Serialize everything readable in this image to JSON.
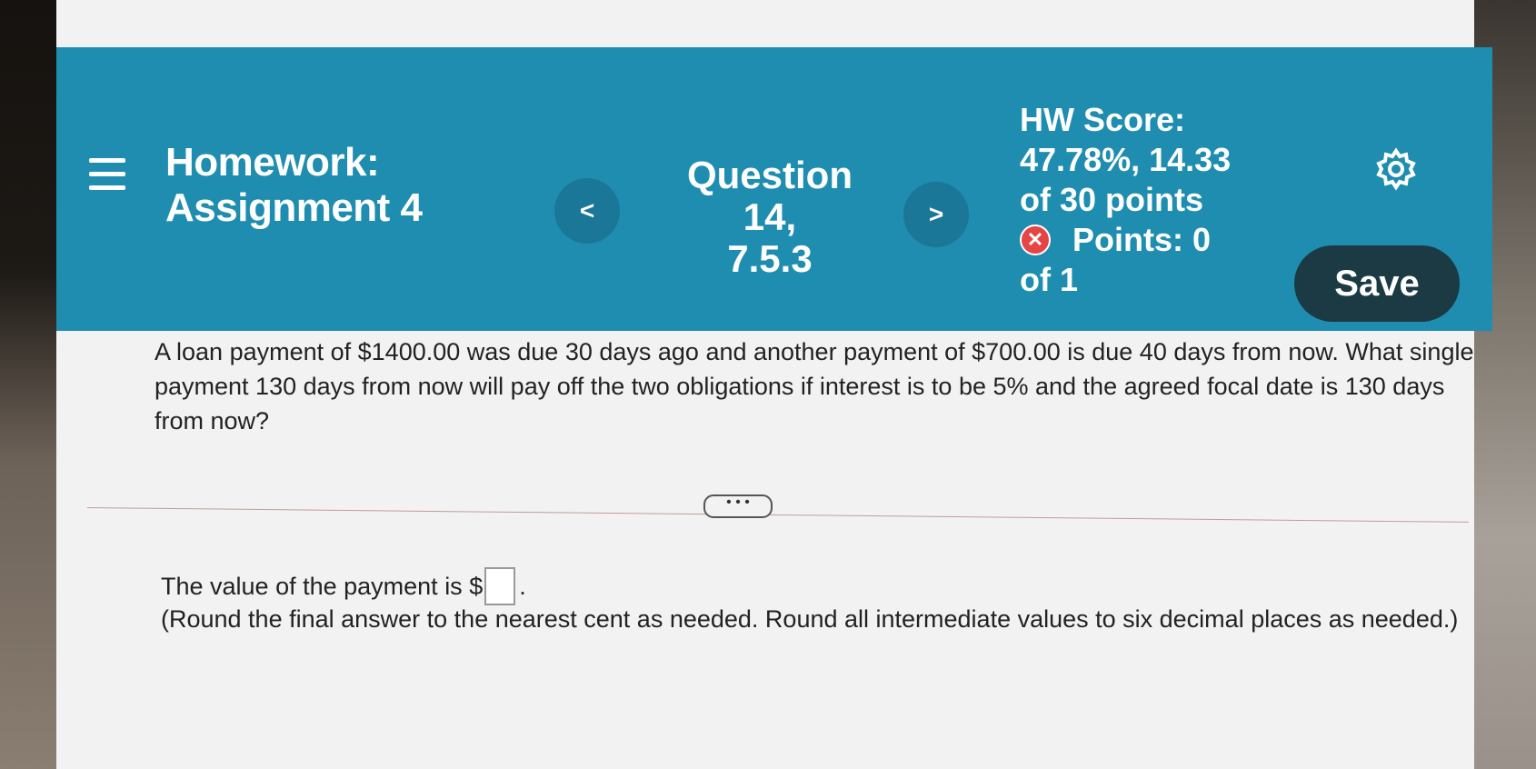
{
  "header": {
    "homework_title_line1": "Homework:",
    "homework_title_line2": "Assignment 4",
    "prev_label": "<",
    "next_label": ">",
    "question_line1": "Question 14,",
    "question_line2": "7.5.3",
    "hw_score_label": "HW Score:",
    "hw_score_value": "47.78%, 14.33",
    "hw_score_points": "of 30 points",
    "points_label": "Points: 0",
    "points_of": "of 1",
    "save_label": "Save"
  },
  "question": {
    "text": "A loan payment of $1400.00 was due 30 days ago and another payment of $700.00 is due 40 days from now. What single payment 130 days from now will pay off the two obligations if interest is to be 5% and the agreed focal date is 130 days from now?",
    "more_label": "• • •",
    "answer_prefix": "The value of the payment is $",
    "answer_suffix": ".",
    "answer_value": "",
    "round_note": "(Round the final answer to the nearest cent as needed. Round all intermediate values to six decimal places as needed.)"
  },
  "icons": {
    "menu": "hamburger-icon",
    "settings": "gear-icon",
    "incorrect": "x-circle-icon"
  },
  "colors": {
    "header": "#1f8db0",
    "save_button": "#1b3a44",
    "incorrect": "#e54545"
  }
}
